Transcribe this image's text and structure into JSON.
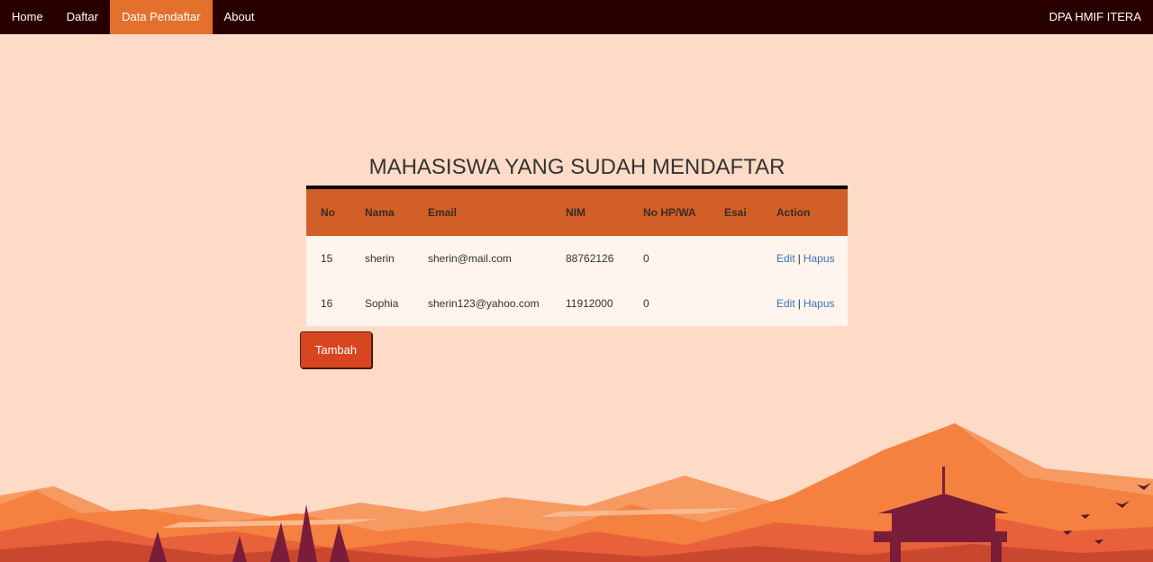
{
  "nav": {
    "items": [
      {
        "label": "Home",
        "active": false
      },
      {
        "label": "Daftar",
        "active": false
      },
      {
        "label": "Data Pendaftar",
        "active": true
      },
      {
        "label": "About",
        "active": false
      }
    ],
    "brand": "DPA HMIF ITERA"
  },
  "title": "MAHASISWA YANG SUDAH MENDAFTAR",
  "table": {
    "headers": [
      "No",
      "Nama",
      "Email",
      "NIM",
      "No HP/WA",
      "Esai",
      "Action"
    ],
    "rows": [
      {
        "no": "15",
        "nama": "sherin",
        "email": "sherin@mail.com",
        "nim": "88762126",
        "hp": "0",
        "esai": "",
        "edit": "Edit",
        "sep": "|",
        "hapus": "Hapus"
      },
      {
        "no": "16",
        "nama": "Sophia",
        "email": "sherin123@yahoo.com",
        "nim": "11912000",
        "hp": "0",
        "esai": "",
        "edit": "Edit",
        "sep": "|",
        "hapus": "Hapus"
      }
    ]
  },
  "button": {
    "tambah": "Tambah"
  },
  "colors": {
    "navbar": "#280000",
    "nav_active": "#e3702c",
    "background": "#fedbc6",
    "table_header": "#d15f27",
    "link": "#3c73b5",
    "button": "#d8461f"
  }
}
